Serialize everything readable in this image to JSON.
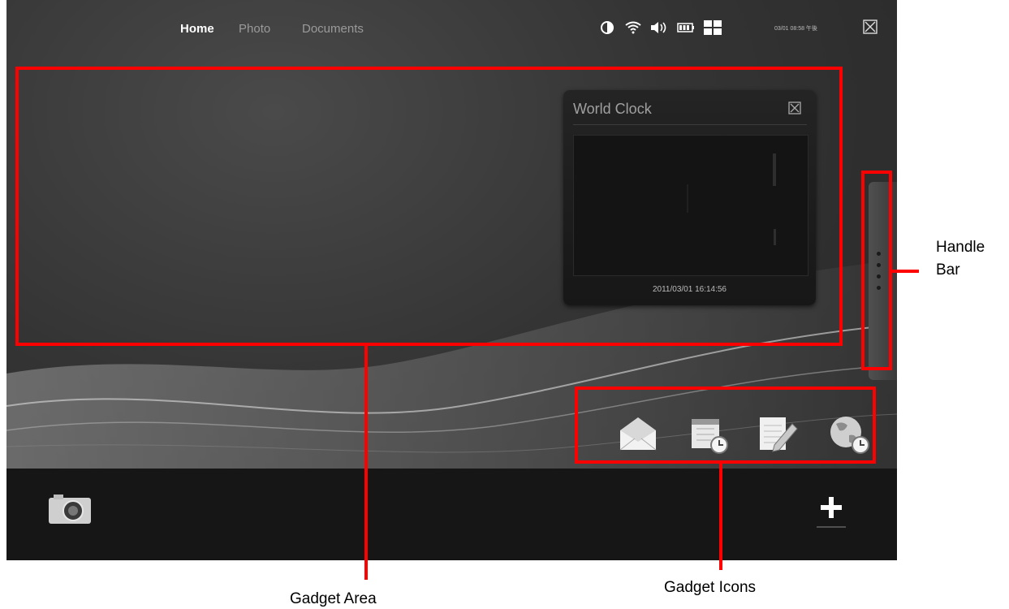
{
  "nav": {
    "tabs": [
      {
        "label": "Home",
        "active": true
      },
      {
        "label": "Photo",
        "active": false
      },
      {
        "label": "Documents",
        "active": false
      }
    ]
  },
  "status_bar": {
    "icons": [
      "brightness-icon",
      "wifi-icon",
      "volume-icon",
      "battery-icon",
      "grid-view-icon"
    ],
    "datetime": "03/01 08:58 午後"
  },
  "world_clock": {
    "title": "World Clock",
    "date_time": "2011/03/01 16:14:56"
  },
  "gadget_icons": [
    "mail-gadget-icon",
    "calendar-gadget-icon",
    "notepad-gadget-icon",
    "world-clock-gadget-icon"
  ],
  "dock": {
    "left_icon": "camera-icon",
    "right_icon": "add-icon"
  },
  "annotations": {
    "gadget_area": "Gadget Area",
    "gadget_icons": "Gadget Icons",
    "handle_bar_line1": "Handle",
    "handle_bar_line2": "Bar"
  },
  "colors": {
    "annotation": "#ff0000",
    "screen_bg": "#343434",
    "dock_bg": "#161616"
  }
}
